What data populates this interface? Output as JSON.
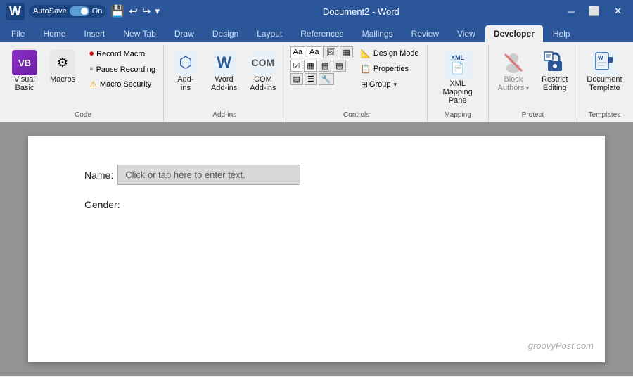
{
  "titleBar": {
    "autosave": "AutoSave",
    "autosave_state": "On",
    "title": "Document2 - Word",
    "undo_icon": "↩",
    "redo_icon": "↪"
  },
  "tabs": [
    {
      "label": "File",
      "active": false
    },
    {
      "label": "Home",
      "active": false
    },
    {
      "label": "Insert",
      "active": false
    },
    {
      "label": "New Tab",
      "active": false
    },
    {
      "label": "Draw",
      "active": false
    },
    {
      "label": "Design",
      "active": false
    },
    {
      "label": "Layout",
      "active": false
    },
    {
      "label": "References",
      "active": false
    },
    {
      "label": "Mailings",
      "active": false
    },
    {
      "label": "Review",
      "active": false
    },
    {
      "label": "View",
      "active": false
    },
    {
      "label": "Developer",
      "active": true
    },
    {
      "label": "Help",
      "active": false
    }
  ],
  "ribbon": {
    "groups": {
      "code": {
        "label": "Code",
        "visual_basic": "Visual\nBasic",
        "macros": "Macros",
        "record_macro": "Record Macro",
        "pause_recording": "Pause Recording",
        "macro_security": "Macro Security"
      },
      "add_ins": {
        "label": "Add-ins",
        "add_ins": "Add-\nins",
        "word_add_ins": "Word\nAdd-ins",
        "com_add_ins": "COM\nAdd-ins"
      },
      "controls": {
        "label": "Controls",
        "design_mode": "Design Mode",
        "properties": "Properties",
        "group": "Group"
      },
      "mapping": {
        "label": "Mapping",
        "xml_mapping": "XML Mapping\nPane"
      },
      "protect": {
        "label": "Protect",
        "block_authors": "Block\nAuthors",
        "restrict_editing": "Restrict\nEditing"
      },
      "templates": {
        "label": "Templates",
        "document_template": "Document\nTemplate"
      }
    }
  },
  "document": {
    "name_label": "Name:",
    "name_placeholder": "Click or tap here to enter text.",
    "gender_label": "Gender:",
    "watermark": "groovyPost.com"
  }
}
